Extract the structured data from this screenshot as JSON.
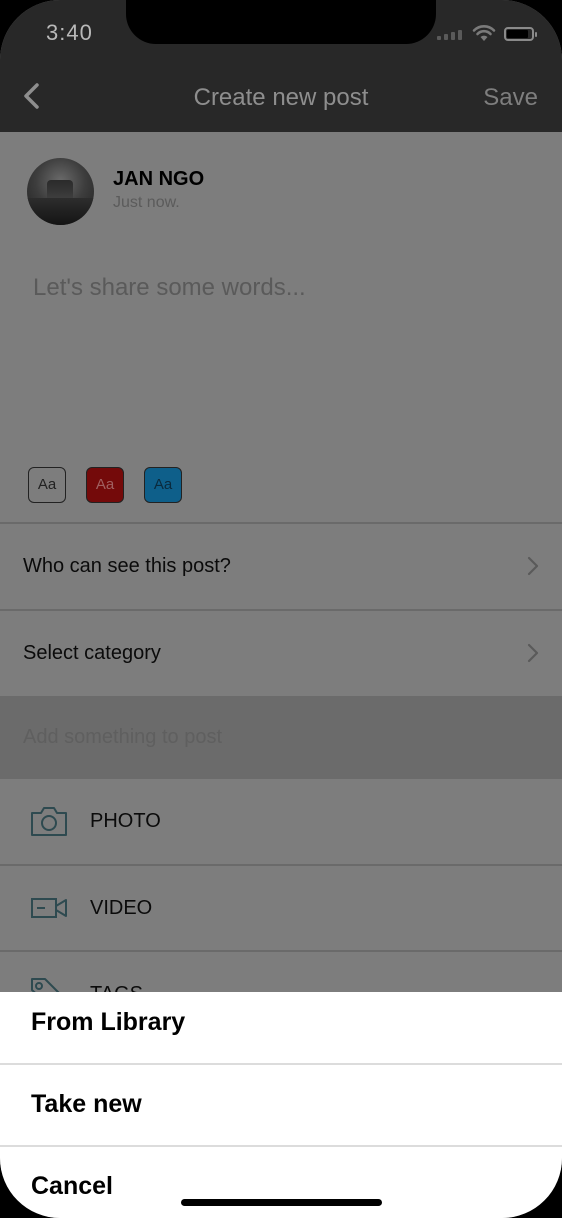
{
  "status_bar": {
    "time": "3:40"
  },
  "nav": {
    "title": "Create new post",
    "save_label": "Save"
  },
  "author": {
    "name": "JAN NGO",
    "time": "Just now."
  },
  "composer": {
    "placeholder": "Let's share some words..."
  },
  "text_styles": [
    {
      "label": "Aa",
      "color": "#ffffff"
    },
    {
      "label": "Aa",
      "color": "#740a0a"
    },
    {
      "label": "Aa",
      "color": "#0e5f8a"
    }
  ],
  "settings": {
    "visibility_label": "Who can see this post?",
    "category_label": "Select category"
  },
  "add_section": {
    "label": "Add something to post"
  },
  "options": [
    {
      "label": "PHOTO",
      "icon": "camera-icon"
    },
    {
      "label": "VIDEO",
      "icon": "video-icon"
    },
    {
      "label": "TAGS",
      "icon": "tag-icon"
    }
  ],
  "action_sheet": {
    "items": [
      "From Library",
      "Take new",
      "Cancel"
    ]
  },
  "colors": {
    "nav_background": "#282828",
    "overlay_background": "#7d7d7d",
    "sheet_background": "#ffffff"
  }
}
